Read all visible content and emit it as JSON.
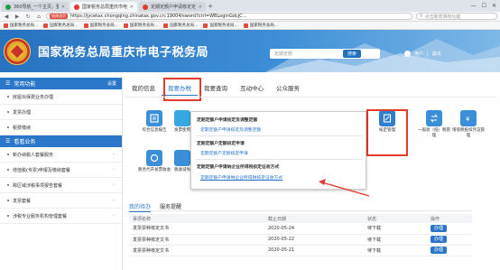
{
  "browser": {
    "tabs": [
      {
        "label": "360导航_一个主页，整个世界",
        "favicon": "#2a9b45",
        "active": false
      },
      {
        "label": "国家税务总局重庆市电子税务局",
        "favicon": "#e1392b",
        "active": true
      },
      {
        "label": "定期定额户申请核定定额说明",
        "favicon": "#e1392b",
        "active": false
      }
    ],
    "new_tab": "+",
    "window_controls": [
      "—",
      "☐",
      "✕"
    ],
    "url_badge": "城建选项",
    "url": "https://jycetax.chongqing.chinatax.gov.cn:19004/sword?ctrl=WBLoginGdcjC...",
    "search_placeholder": "点击新增准地功能",
    "bookmarks": [
      "国家税务总局...",
      "国家税务总局...",
      "国家税务总局...",
      "国家税务总局...",
      "国家税务总局...",
      "国家税务总局...",
      "国家税务总局..."
    ]
  },
  "header": {
    "title": "国家税务总局重庆市电子税务局",
    "search_placeholder": "定期定额",
    "search_button": "搜索",
    "user": "用户",
    "logout": "退出"
  },
  "sidebar": {
    "common_head": "常用功能",
    "settings": "设置",
    "common_items": [
      "房屋出保费业务办理",
      "发票办理",
      "税费缴纳"
    ],
    "center_head": "看看业务",
    "center_items": [
      "新办纳税人套餐服务",
      "增值税(专票)申报及缴纳套餐",
      "跨区域涉税事项报告套餐",
      "发票套餐",
      "涉税专业服务机构管理套餐"
    ]
  },
  "nav": {
    "tabs": [
      "我的信息",
      "我要办税",
      "我要查询",
      "互动中心",
      "公众服务"
    ],
    "active_index": 1
  },
  "icons": [
    {
      "label": "综合信息报告",
      "color": "#3b8fd9"
    },
    {
      "label": "发票使用",
      "color": "#37a7e0"
    },
    {
      "label": "税务代开发票收收",
      "color": "#3b8fd9"
    },
    {
      "label": "税收减免",
      "color": "#3b8fd9"
    },
    {
      "label": "核定管理",
      "color": "#2f7fcc"
    },
    {
      "label": "一般退（抵）税管理",
      "color": "#3b8fd9"
    },
    {
      "label": "增值税抵扣凭证管理",
      "color": "#3b8fd9"
    }
  ],
  "dropdown": {
    "heading1": "定期定额户申请核定及调整定额",
    "sub1": "定期定额户申请核定及调整定额",
    "heading2": "定期定额户定额核定申请",
    "sub2": "定期定额户定额核定申请",
    "heading3": "定期定额户申请纳企业所得税核定征收方式",
    "sub3": "定期定额户申请纳企业所得税核定征收方式"
  },
  "todo": {
    "tabs": [
      "我的待办",
      "服务提醒"
    ],
    "columns": [
      "事项名称",
      "截止日期",
      "状态",
      "操作"
    ],
    "rows": [
      {
        "name": "发票票种核定文书",
        "date": "2020-05-24",
        "status": "待下载",
        "action": "办理"
      },
      {
        "name": "发票票种核定文书",
        "date": "2020-05-22",
        "status": "待下载",
        "action": "办理"
      },
      {
        "name": "发票票种核定文书",
        "date": "2020-05-21",
        "status": "待下载",
        "action": "办理"
      }
    ]
  },
  "colors": {
    "brand": "#2a76c8",
    "highlight": "#e23a2f"
  }
}
